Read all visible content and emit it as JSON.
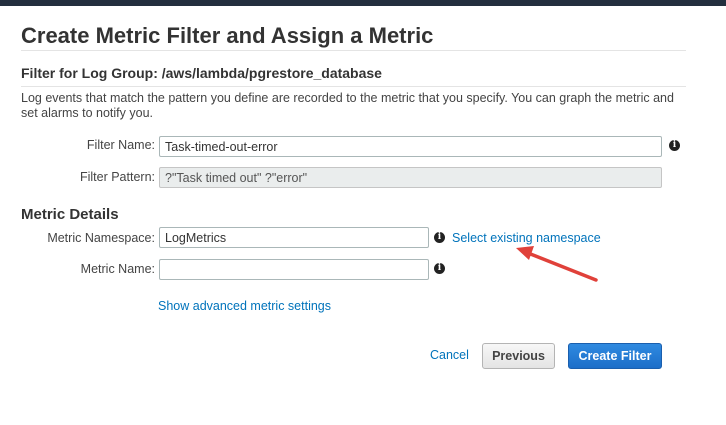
{
  "page": {
    "title": "Create Metric Filter and Assign a Metric",
    "subtitle": "Filter for Log Group: /aws/lambda/pgrestore_database",
    "description": "Log events that match the pattern you define are recorded to the metric that you specify. You can graph the metric and set alarms to notify you."
  },
  "filter": {
    "name_label": "Filter Name:",
    "name_value": "Task-timed-out-error",
    "pattern_label": "Filter Pattern:",
    "pattern_value": "?\"Task timed out\" ?\"error\""
  },
  "metric": {
    "section_title": "Metric Details",
    "namespace_label": "Metric Namespace:",
    "namespace_value": "LogMetrics",
    "select_namespace_link": "Select existing namespace",
    "name_label": "Metric Name:",
    "name_value": "",
    "advanced_link": "Show advanced metric settings"
  },
  "actions": {
    "cancel": "Cancel",
    "previous": "Previous",
    "create": "Create Filter"
  },
  "icons": {
    "info": "info-icon",
    "annotation": "red-arrow"
  },
  "colors": {
    "link": "#0073bb",
    "primary_button": "#1c6ec9",
    "annotation_arrow": "#e0413a"
  }
}
